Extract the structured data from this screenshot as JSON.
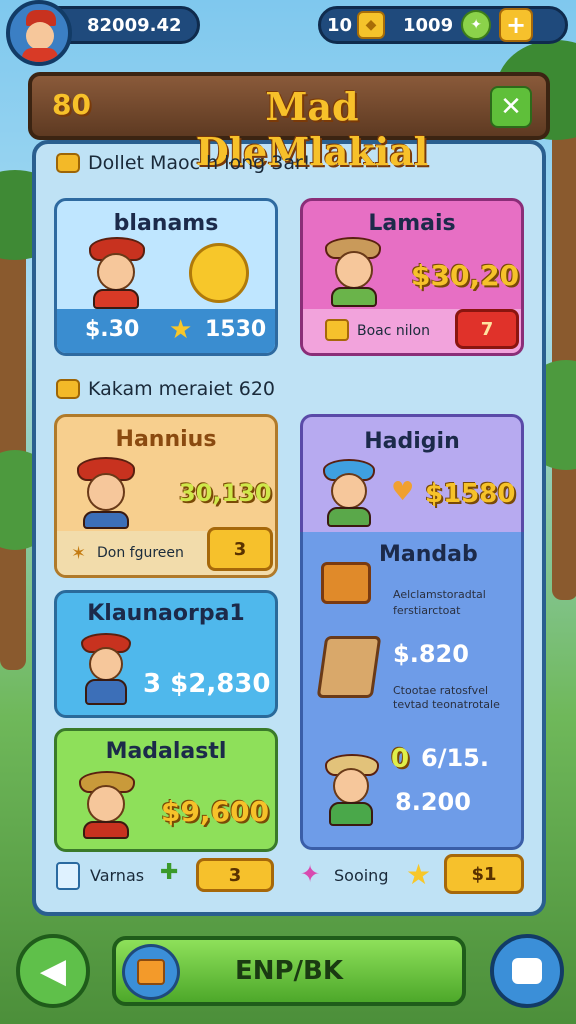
{
  "hud": {
    "coins": "82009.42",
    "keys": "10",
    "gems": "1009"
  },
  "banner": {
    "left_text": "80",
    "title": "Mad DleMlakial"
  },
  "section1": {
    "heading": "Dollet Maoc h long 3ar!"
  },
  "section2": {
    "heading": "Kakam meraiet 620"
  },
  "cards": {
    "blanams": {
      "title": "blanams",
      "left_price": "$.30",
      "right_value": "1530"
    },
    "lamais": {
      "title": "Lamais",
      "price": "$30,20",
      "footer_text": "Boac nilon",
      "button": "7"
    },
    "hannius": {
      "title": "Hannius",
      "price": "30,130",
      "footer_text": "Don fgureen",
      "button": "3"
    },
    "hadigin": {
      "title": "Hadigin",
      "price": "$1580"
    },
    "mandab": {
      "title": "Mandab",
      "desc1": "Aelclamstoradtal",
      "desc2": "ferstiarctoat",
      "price1": "$.820",
      "desc3": "Ctootae ratosfvel",
      "desc4": "tevtad teonatrotale",
      "price2_prefix": "0",
      "price2": "6/15.",
      "price3": "8.200"
    },
    "klaunaorpal": {
      "title": "Klaunaorpa1",
      "price": "3 $2,830"
    },
    "madalastl": {
      "title": "Madalastl",
      "price": "$9,600"
    }
  },
  "footer": {
    "left_label": "Varnas",
    "left_button": "3",
    "right_label": "Sooing",
    "right_button": "$1"
  },
  "nav": {
    "main_button": "ENP/BK"
  }
}
